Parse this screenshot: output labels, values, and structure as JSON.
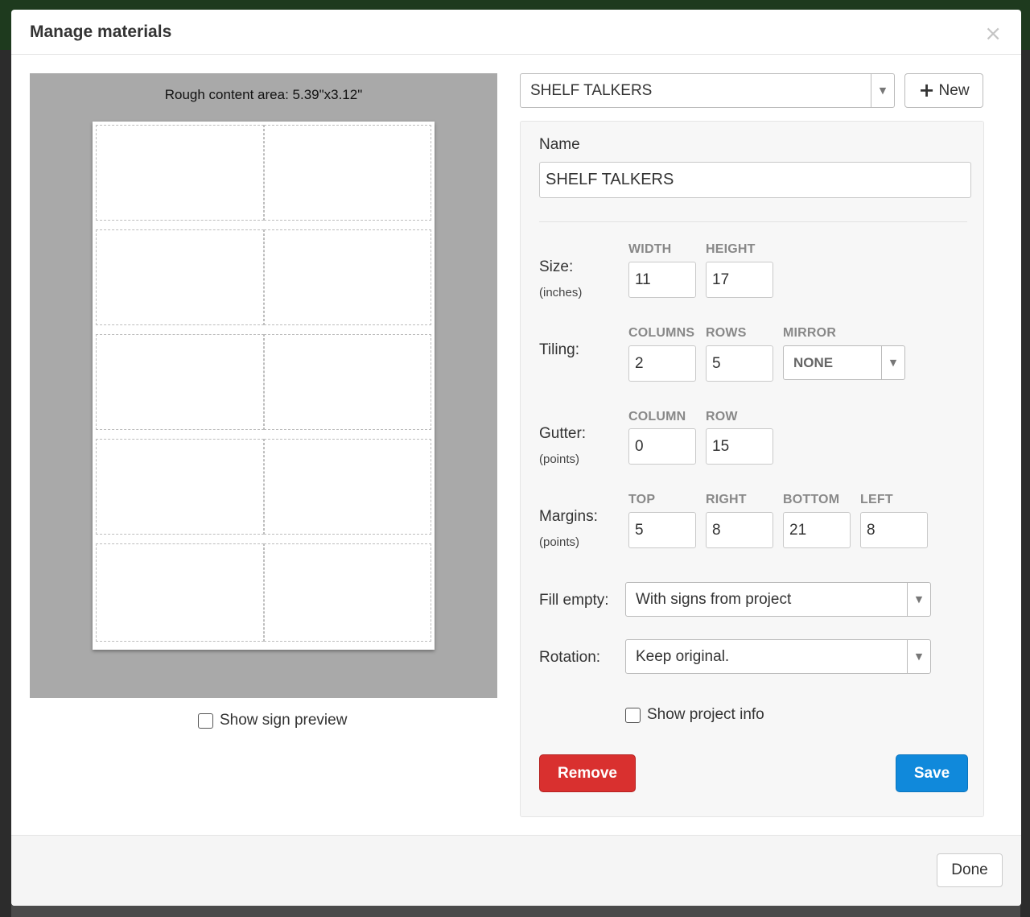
{
  "modal": {
    "title": "Manage materials",
    "close_glyph": "×",
    "done_label": "Done"
  },
  "preview": {
    "caption": "Rough content area: 5.39\"x3.12\"",
    "show_sign_preview_label": "Show sign preview",
    "show_sign_preview_checked": false
  },
  "material_select": {
    "value": "SHELF TALKERS",
    "arrow_glyph": "▼"
  },
  "new_button": {
    "icon": "plus-icon",
    "plus_glyph": "+",
    "label": "New"
  },
  "form": {
    "name_label": "Name",
    "name_value": "SHELF TALKERS",
    "size": {
      "label": "Size:",
      "unit": "(inches)",
      "width_header": "WIDTH",
      "height_header": "HEIGHT",
      "width": "11",
      "height": "17"
    },
    "tiling": {
      "label": "Tiling:",
      "columns_header": "COLUMNS",
      "rows_header": "ROWS",
      "mirror_header": "MIRROR",
      "columns": "2",
      "rows": "5",
      "mirror": "NONE"
    },
    "gutter": {
      "label": "Gutter:",
      "unit": "(points)",
      "column_header": "COLUMN",
      "row_header": "ROW",
      "column": "0",
      "row": "15"
    },
    "margins": {
      "label": "Margins:",
      "unit": "(points)",
      "top_header": "TOP",
      "right_header": "RIGHT",
      "bottom_header": "BOTTOM",
      "left_header": "LEFT",
      "top": "5",
      "right": "8",
      "bottom": "21",
      "left": "8"
    },
    "fill_empty": {
      "label": "Fill empty:",
      "value": "With signs from project"
    },
    "rotation": {
      "label": "Rotation:",
      "value": "Keep original."
    },
    "show_project_info": {
      "label": "Show project info",
      "checked": false
    },
    "remove_label": "Remove",
    "save_label": "Save"
  },
  "colors": {
    "remove": "#d9302f",
    "save": "#1089db",
    "preview_bg": "#a9a9a9"
  }
}
